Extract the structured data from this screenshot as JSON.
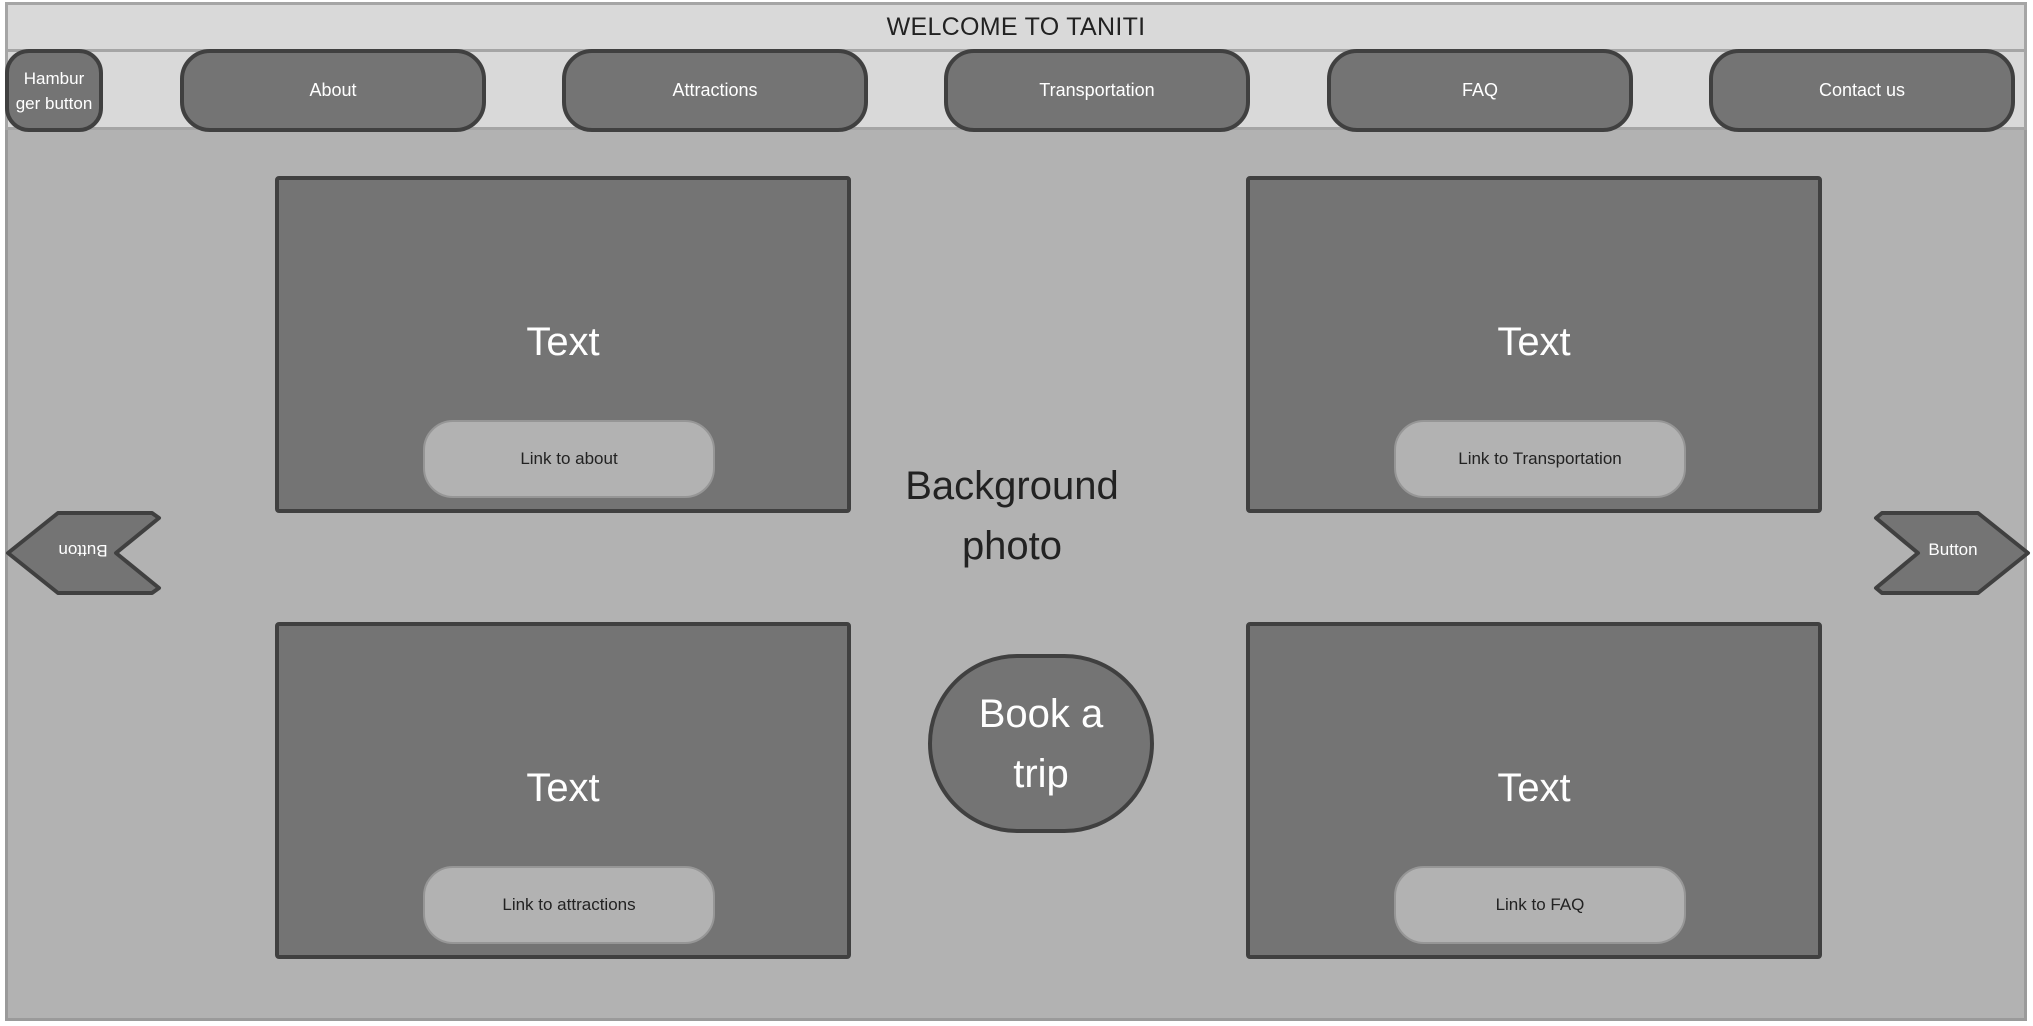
{
  "header": {
    "title": "WELCOME TO TANITI"
  },
  "nav": {
    "hamburger_label": "Hambur\nger button",
    "items": [
      {
        "label": "About"
      },
      {
        "label": "Attractions"
      },
      {
        "label": "Transportation"
      },
      {
        "label": "FAQ"
      },
      {
        "label": "Contact us"
      }
    ]
  },
  "main": {
    "background_label": "Background\nphoto",
    "book_label": "Book a\ntrip",
    "cards": [
      {
        "text": "Text",
        "link": "Link to about"
      },
      {
        "text": "Text",
        "link": "Link to Transportation"
      },
      {
        "text": "Text",
        "link": "Link to attractions"
      },
      {
        "text": "Text",
        "link": "Link to FAQ"
      }
    ],
    "prev_button_label": "Button",
    "next_button_label": "Button"
  },
  "colors": {
    "page_background": "#b2b2b2",
    "bar_background": "#d9d9d9",
    "element_fill": "#747474",
    "element_border": "#404040",
    "text_light": "#ffffff",
    "text_dark": "#222222"
  }
}
